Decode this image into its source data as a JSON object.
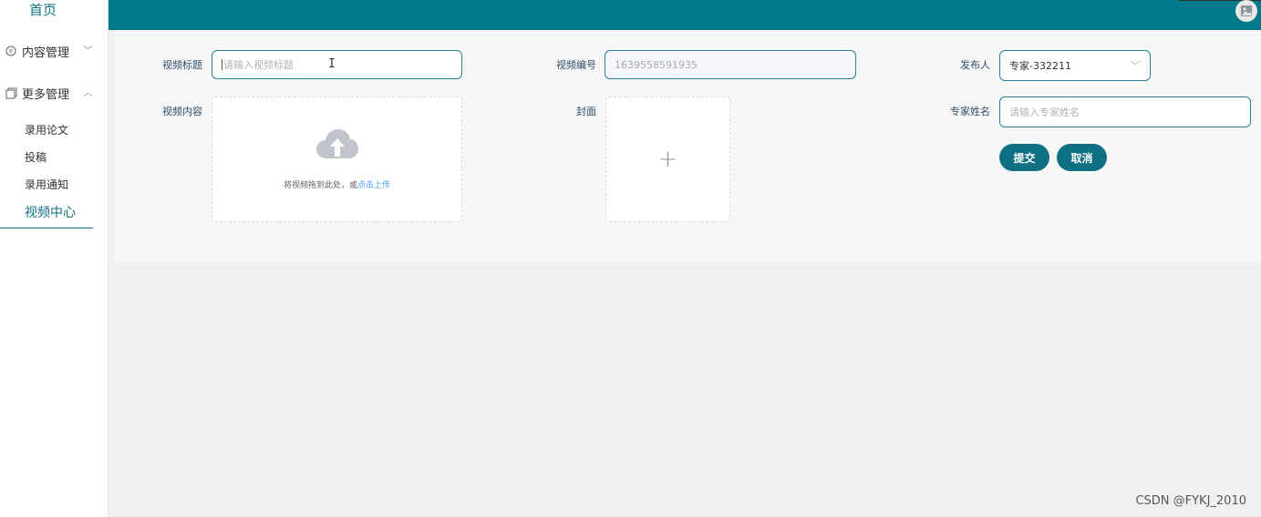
{
  "sidebar": {
    "home": "首页",
    "groups": [
      {
        "label": "内容管理",
        "arrow": "﹀"
      },
      {
        "label": "更多管理",
        "arrow": "︿"
      }
    ],
    "items": [
      {
        "label": "录用论文"
      },
      {
        "label": "投稿"
      },
      {
        "label": "录用通知"
      },
      {
        "label": "视频中心"
      }
    ]
  },
  "form": {
    "title_label": "视频标题",
    "title_placeholder": "请输入视频标题",
    "code_label": "视频编号",
    "code_value": "1639558591935",
    "publisher_label": "发布人",
    "publisher_value": "专家-332211",
    "content_label": "视频内容",
    "upload_hint": "将视频拖到此处，或",
    "upload_link": "点击上传",
    "cover_label": "封面",
    "cover_plus": "+",
    "expert_label": "专家姓名",
    "expert_placeholder": "请输入专家姓名",
    "submit_label": "提交",
    "cancel_label": "取消"
  },
  "watermark": "CSDN @FYKJ_2010",
  "colors": {
    "primary": "#00798b",
    "button": "#0e7082",
    "link": "#409eff"
  }
}
